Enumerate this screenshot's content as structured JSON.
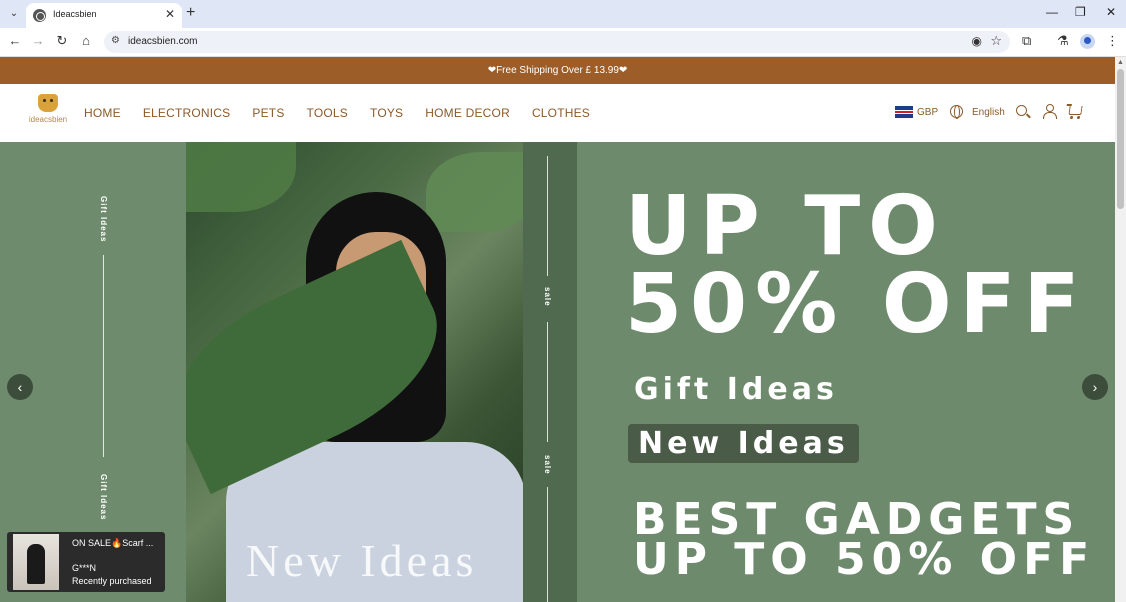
{
  "browser": {
    "tab_title": "Ideacsbien",
    "url": "ideacsbien.com",
    "new_tab_symbol": "+",
    "tab_close_symbol": "✕",
    "window_controls": {
      "minimize": "—",
      "restore": "❐",
      "close": "✕"
    }
  },
  "announcement": "❤Free Shipping Over £ 13.99❤",
  "site": {
    "logo_text": "ideacsbien",
    "nav": [
      "HOME",
      "ELECTRONICS",
      "PETS",
      "TOOLS",
      "TOYS",
      "HOME DECOR",
      "CLOTHES"
    ],
    "currency": "GBP",
    "language": "English"
  },
  "hero": {
    "side_label": "Gift Ideas",
    "strip_label": "sale",
    "photo_caption": "New Ideas",
    "headline_line1": "UP TO",
    "headline_line2": "50% OFF",
    "gift_ideas": "Gift Ideas",
    "new_ideas_badge": "New Ideas",
    "best_line1": "BEST GADGETS",
    "best_line2": "UP TO 50% OFF",
    "prev_arrow": "‹",
    "next_arrow": "›"
  },
  "popup": {
    "title": "ON SALE🔥Scarf ...",
    "buyer": "G***N",
    "status": "Recently purchased"
  },
  "colors": {
    "announcement_bg": "#9c5d28",
    "nav_text": "#8b5a2b",
    "hero_bg": "#6e8a6c"
  }
}
